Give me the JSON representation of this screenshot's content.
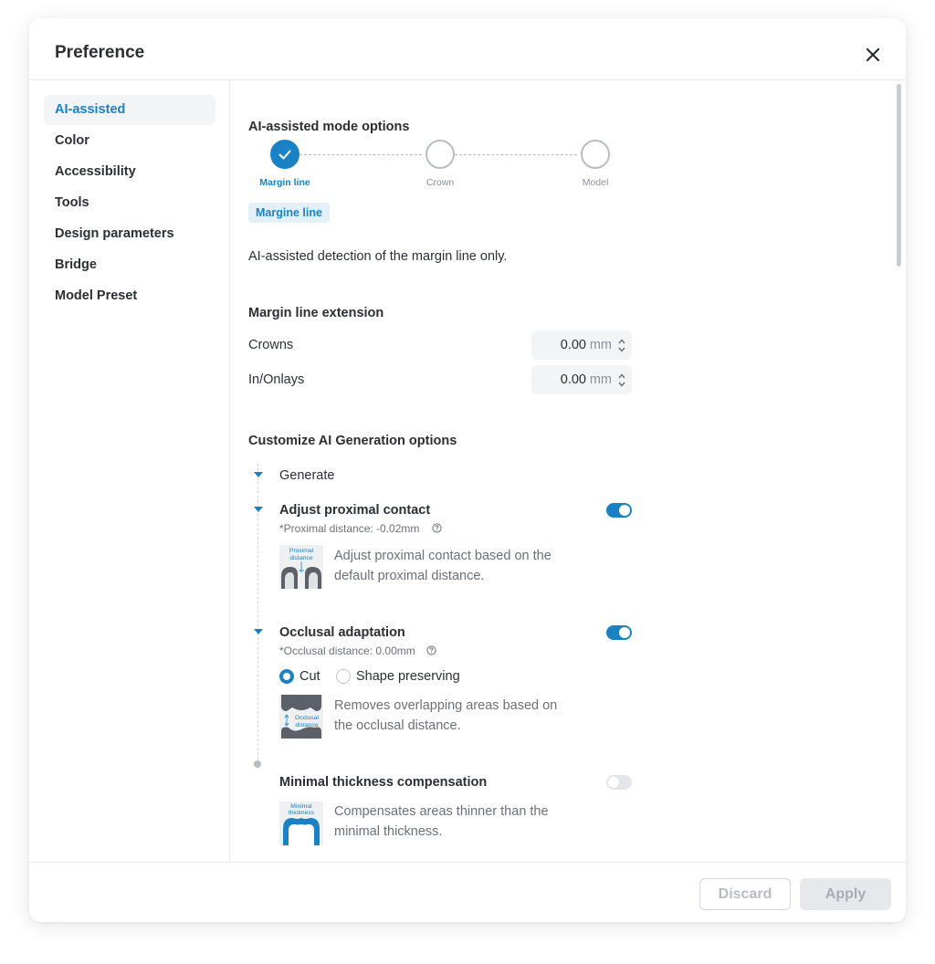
{
  "dialog": {
    "title": "Preference"
  },
  "sidebar": {
    "items": [
      {
        "label": "AI-assisted",
        "active": true
      },
      {
        "label": "Color"
      },
      {
        "label": "Accessibility"
      },
      {
        "label": "Tools"
      },
      {
        "label": "Design parameters"
      },
      {
        "label": "Bridge"
      },
      {
        "label": "Model Preset"
      }
    ]
  },
  "ai_mode": {
    "title": "AI-assisted mode options",
    "steps": [
      {
        "label": "Margin line",
        "state": "done"
      },
      {
        "label": "Crown",
        "state": "pending"
      },
      {
        "label": "Model",
        "state": "pending"
      }
    ],
    "badge": "Margine line",
    "description": "AI-assisted detection of the margin line only."
  },
  "extension": {
    "title": "Margin line extension",
    "rows": [
      {
        "label": "Crowns",
        "value": "0.00",
        "unit": "mm"
      },
      {
        "label": "In/Onlays",
        "value": "0.00",
        "unit": "mm"
      }
    ]
  },
  "generation": {
    "title": "Customize AI Generation options",
    "generate_label": "Generate",
    "proximal": {
      "label": "Adjust proximal contact",
      "sub": "*Proximal distance: -0.02mm",
      "enabled": true,
      "thumb_text_1": "Proximal",
      "thumb_text_2": "distance",
      "description_1": "Adjust proximal contact based on the",
      "description_2": "default proximal distance."
    },
    "occlusal": {
      "label": "Occlusal adaptation",
      "sub": "*Occlusal distance: 0.00mm",
      "enabled": true,
      "options": [
        {
          "label": "Cut",
          "checked": true
        },
        {
          "label": "Shape preserving",
          "checked": false
        }
      ],
      "thumb_text_1": "Occlusal",
      "thumb_text_2": "distance",
      "description_1": "Removes overlapping areas based on",
      "description_2": "the occlusal distance."
    },
    "thickness": {
      "label": "Minimal thickness compensation",
      "enabled": false,
      "thumb_text_1": "Minimal",
      "thumb_text_2": "thickness",
      "description_1": "Compensates areas thinner than the",
      "description_2": "minimal thickness."
    }
  },
  "footer": {
    "discard": "Discard",
    "apply": "Apply"
  },
  "colors": {
    "accent": "#1a82c4",
    "text": "#2b2e33",
    "muted": "#6b7078",
    "border": "#e6e8eb"
  },
  "icons": [
    "close-icon",
    "check-icon",
    "caret-down-icon",
    "spinner-up-icon",
    "spinner-down-icon",
    "help-icon"
  ]
}
